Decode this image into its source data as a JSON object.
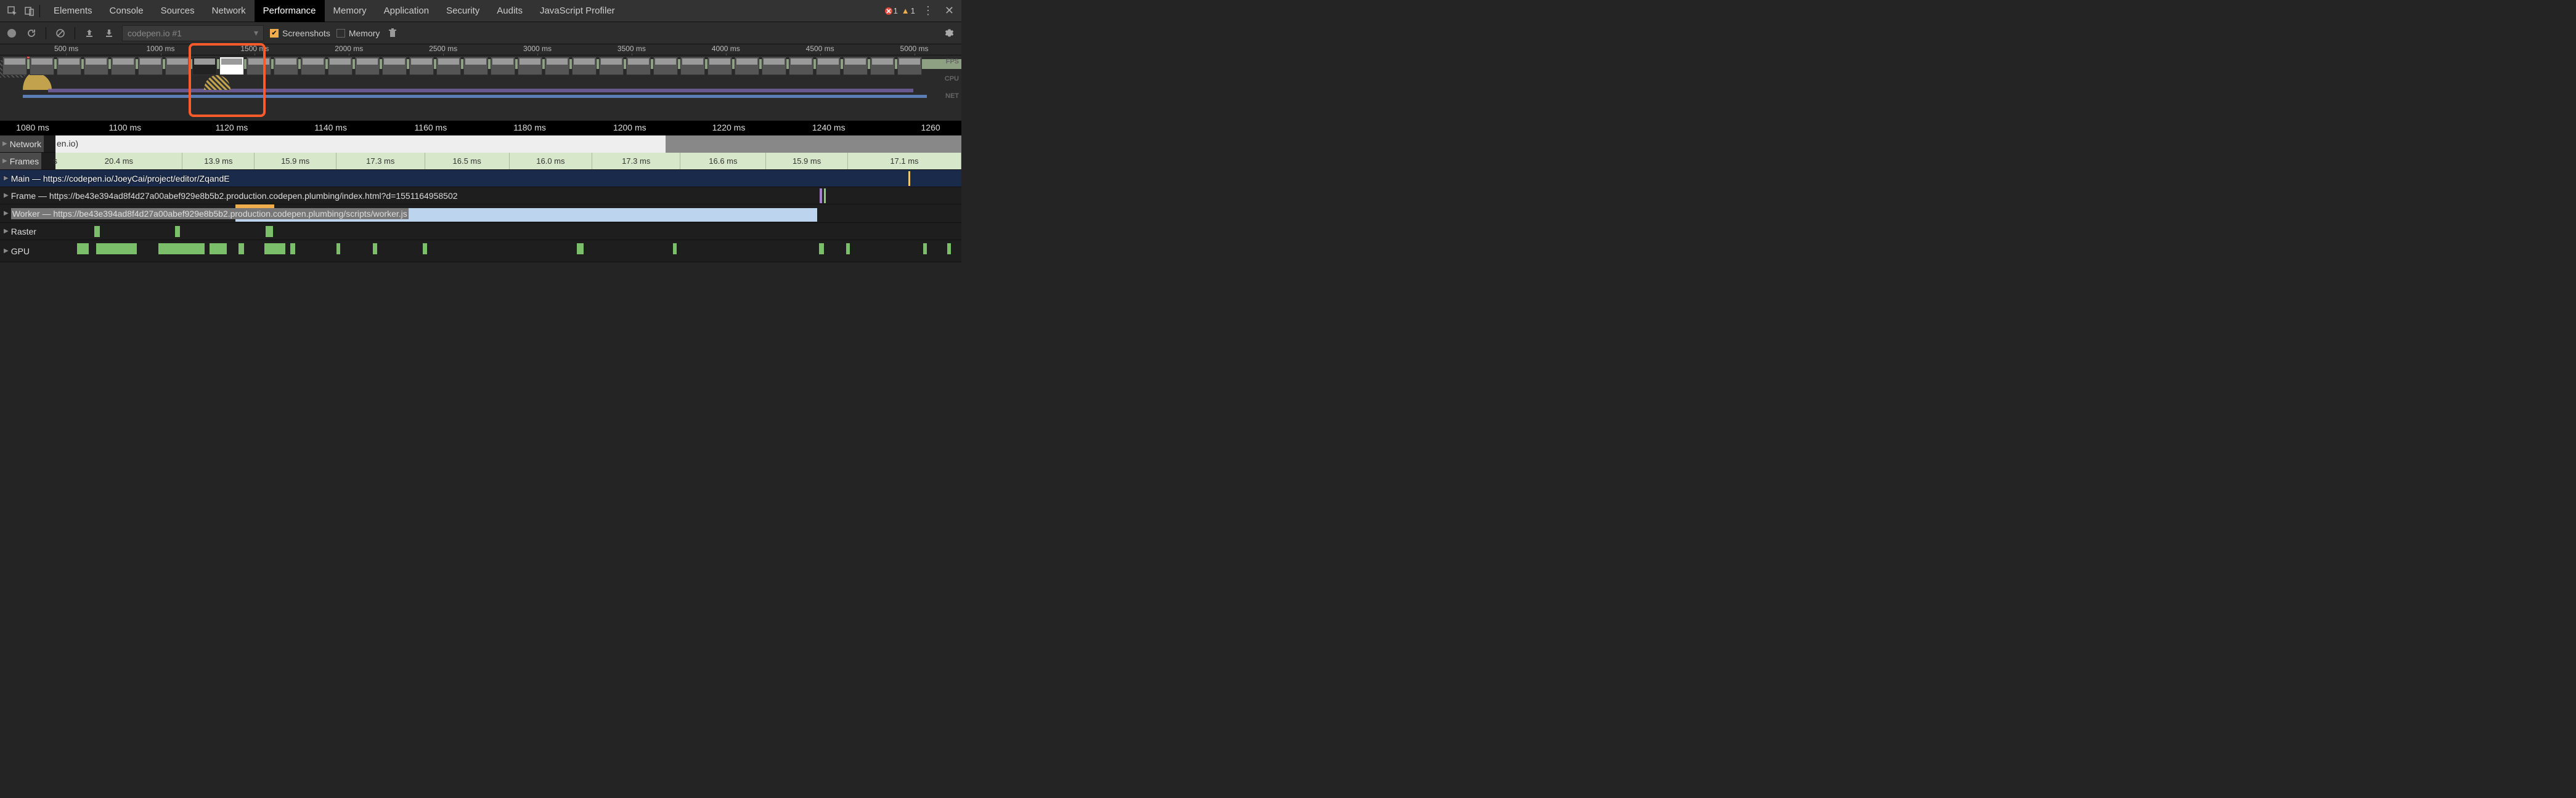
{
  "tabs": {
    "items": [
      "Elements",
      "Console",
      "Sources",
      "Network",
      "Performance",
      "Memory",
      "Application",
      "Security",
      "Audits",
      "JavaScript Profiler"
    ],
    "active": "Performance"
  },
  "errors": {
    "error_count": "1",
    "warn_count": "1"
  },
  "toolbar": {
    "recording_label": "codepen.io #1",
    "screenshots_label": "Screenshots",
    "memory_label": "Memory"
  },
  "overview_ticks": [
    "500 ms",
    "1000 ms",
    "1500 ms",
    "2000 ms",
    "2500 ms",
    "3000 ms",
    "3500 ms",
    "4000 ms",
    "4500 ms",
    "5000 ms"
  ],
  "overview_labels": {
    "fps": "FPS",
    "cpu": "CPU",
    "net": "NET"
  },
  "ruler_ticks": [
    "1080 ms",
    "1100 ms",
    "1120 ms",
    "1140 ms",
    "1160 ms",
    "1180 ms",
    "1200 ms",
    "1220 ms",
    "1240 ms",
    "1260"
  ],
  "tracks": {
    "network": {
      "label": "Network",
      "suffix": "en.io)"
    },
    "frames": {
      "label": "Frames",
      "suffix": "s",
      "values": [
        "20.4 ms",
        "13.9 ms",
        "15.9 ms",
        "17.3 ms",
        "16.5 ms",
        "16.0 ms",
        "17.3 ms",
        "16.6 ms",
        "15.9 ms",
        "17.1 ms"
      ]
    },
    "main": {
      "label": "Main — https://codepen.io/JoeyCai/project/editor/ZqandE"
    },
    "frame": {
      "label": "Frame — https://be43e394ad8f4d27a00abef929e8b5b2.production.codepen.plumbing/index.html?d=1551164958502"
    },
    "worker": {
      "label": "Worker — https://be43e394ad8f4d27a00abef929e8b5b2.production.codepen.plumbing/scripts/worker.js"
    },
    "raster": {
      "label": "Raster"
    },
    "gpu": {
      "label": "GPU"
    }
  }
}
